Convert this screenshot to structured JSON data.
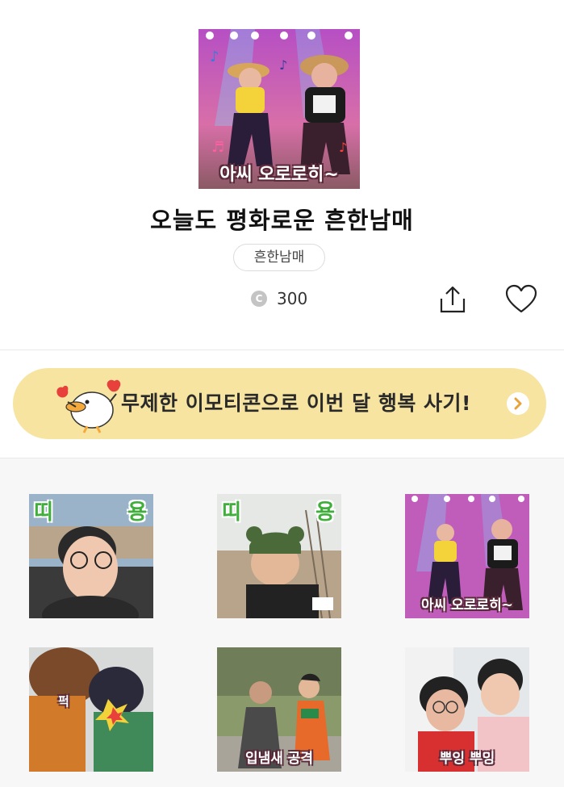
{
  "header": {
    "title": "오늘도 평화로운 흔한남매",
    "author": "흔한남매",
    "price": "300",
    "coin_symbol": "C",
    "hero_caption": "아씨 오로로히~"
  },
  "banner": {
    "text": "무제한 이모티콘으로 이번 달 행복 사기!",
    "arrow": "›"
  },
  "stickers": [
    {
      "left": "띠",
      "right": "용",
      "caption": ""
    },
    {
      "left": "띠",
      "right": "용",
      "caption": ""
    },
    {
      "left": "",
      "right": "",
      "caption": "아씨 오로로히~"
    },
    {
      "left": "",
      "right": "",
      "caption": "퍽"
    },
    {
      "left": "",
      "right": "",
      "caption": "입냄새 공격"
    },
    {
      "left": "",
      "right": "",
      "caption": "뿌잉 뿌잉"
    }
  ],
  "icons": {
    "share": "share-icon",
    "like": "heart-icon",
    "coin": "coin-icon",
    "arrow": "chevron-right-icon"
  },
  "colors": {
    "banner_bg": "#f6e4a0",
    "banner_arrow": "#e8a23a",
    "sticker_corner_text": "#3fae3a",
    "grid_bg": "#f7f7f7"
  }
}
